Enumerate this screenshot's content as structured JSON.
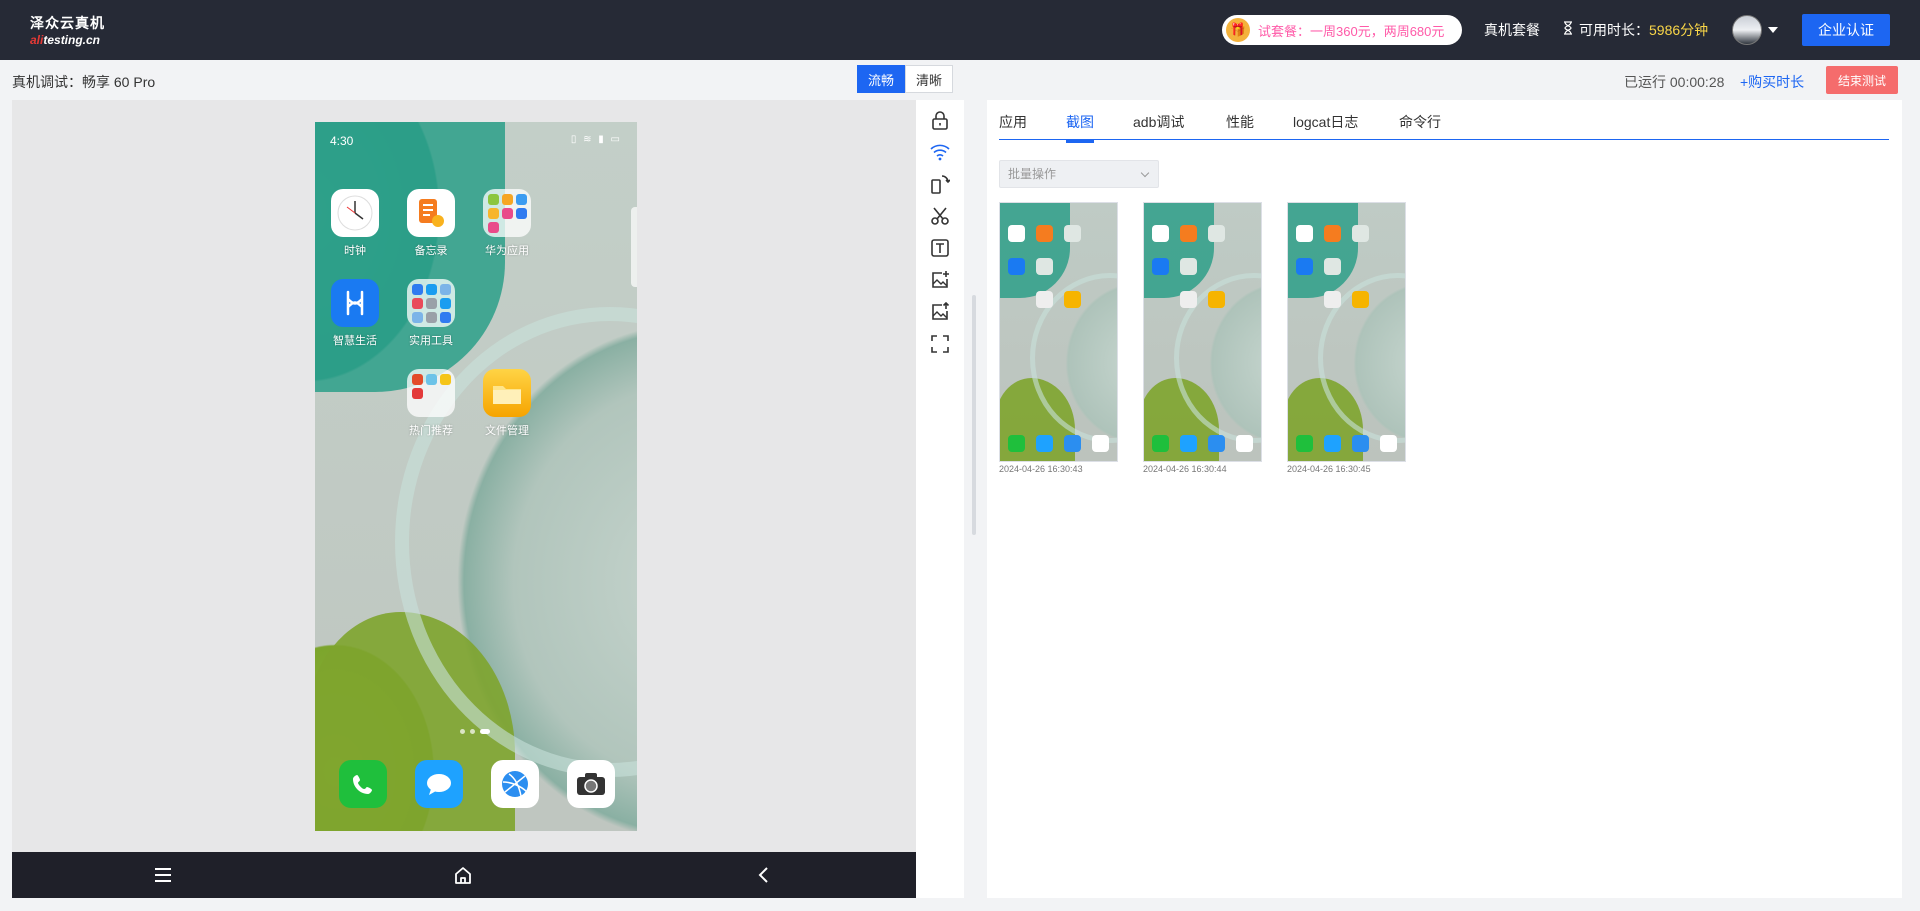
{
  "brand": {
    "name_cn": "泽众云真机",
    "domain_prefix": "ali",
    "domain_rest": "testing.cn"
  },
  "topbar": {
    "promo_text": "试套餐：一周360元，两周680元",
    "plans_label": "真机套餐",
    "available_label": "可用时长：",
    "available_value": "5986分钟",
    "enterprise_button": "企业认证"
  },
  "subbar": {
    "device_title": "真机调试：畅享 60 Pro",
    "quality_options": [
      "流畅",
      "清晰"
    ],
    "quality_selected": "流畅",
    "runtime": "已运行 00:00:28",
    "buy_link": "+购买时长",
    "end_button": "结束测试"
  },
  "phone": {
    "time": "4:30",
    "apps": [
      {
        "label": "时钟",
        "icon": "clock-icon"
      },
      {
        "label": "备忘录",
        "icon": "notes-icon"
      },
      {
        "label": "华为应用",
        "icon": "folder-icon"
      },
      {
        "label": "智慧生活",
        "icon": "smart-life-icon"
      },
      {
        "label": "实用工具",
        "icon": "folder-icon"
      },
      {
        "label": "热门推荐",
        "icon": "folder-icon"
      },
      {
        "label": "文件管理",
        "icon": "files-icon"
      }
    ],
    "dock": [
      "phone-icon",
      "messages-icon",
      "browser-icon",
      "camera-icon"
    ]
  },
  "bottom_nav": [
    "menu-icon",
    "home-icon",
    "back-icon"
  ],
  "tools": [
    "lock-icon",
    "wifi-icon",
    "rotate-icon",
    "scissors-icon",
    "text-icon",
    "image-add-icon",
    "image-upload-icon",
    "fullscreen-icon"
  ],
  "tabs": {
    "items": [
      "应用",
      "截图",
      "adb调试",
      "性能",
      "logcat日志",
      "命令行"
    ],
    "active": "截图"
  },
  "batch_select": {
    "placeholder": "批量操作"
  },
  "screenshots": [
    {
      "timestamp": "2024-04-26 16:30:43"
    },
    {
      "timestamp": "2024-04-26 16:30:44"
    },
    {
      "timestamp": "2024-04-26 16:30:45"
    }
  ],
  "colors": {
    "accent": "#1d66f2",
    "danger": "#f56c6c",
    "topbar": "#262a36",
    "available": "#f9d648"
  }
}
